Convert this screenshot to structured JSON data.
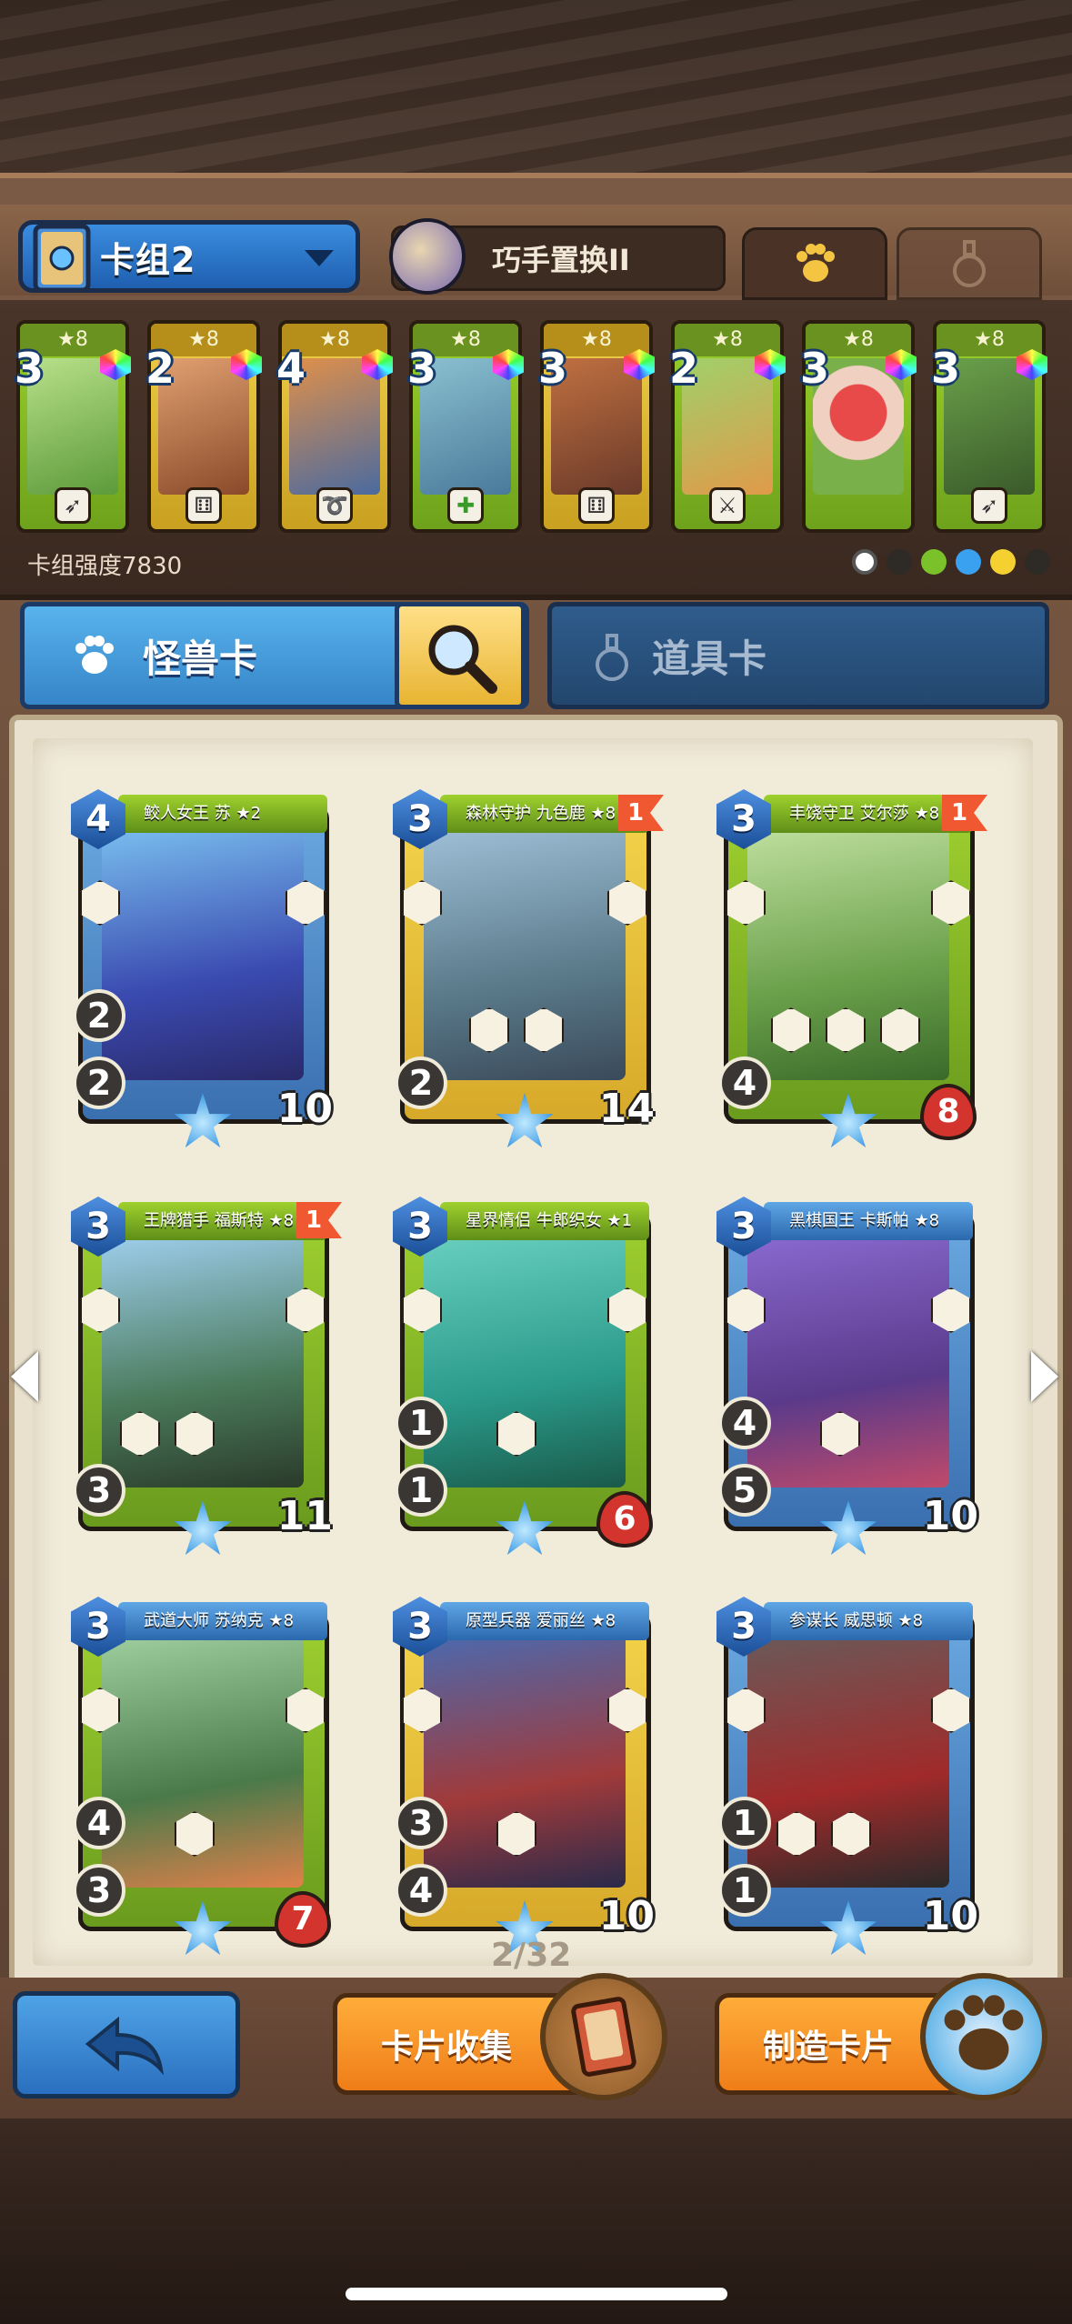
{
  "deck": {
    "name": "卡组2",
    "skill_name": "巧手置换II",
    "strength_label": "卡组强度7830"
  },
  "deck_cards": [
    {
      "cost": "3",
      "stars": "★8",
      "trait": "bow-icon",
      "color": "#9ad12a"
    },
    {
      "cost": "2",
      "stars": "★8",
      "trait": "dice-icon",
      "color": "#e8c44a"
    },
    {
      "cost": "4",
      "stars": "★8",
      "trait": "whip-icon",
      "color": "#e8c44a"
    },
    {
      "cost": "3",
      "stars": "★8",
      "trait": "clover-icon",
      "color": "#9ad12a"
    },
    {
      "cost": "3",
      "stars": "★8",
      "trait": "dice-icon",
      "color": "#e8c44a"
    },
    {
      "cost": "2",
      "stars": "★8",
      "trait": "sword-icon",
      "color": "#9ad12a"
    },
    {
      "cost": "3",
      "stars": "★8",
      "trait": "none",
      "color": "#9ad12a"
    },
    {
      "cost": "3",
      "stars": "★8",
      "trait": "bow-icon",
      "color": "#9ad12a"
    }
  ],
  "tabs": {
    "monster": "怪兽卡",
    "item": "道具卡"
  },
  "cards": [
    {
      "name": "鲛人女王 苏 ★2",
      "cost": "4",
      "flag": "",
      "atk1": "2",
      "atk2": "2",
      "hp": "10",
      "ribbon": "green",
      "art": "#3f6fd1"
    },
    {
      "name": "森林守护 九色鹿 ★8",
      "cost": "3",
      "flag": "1",
      "atk1": "",
      "atk2": "2",
      "hp": "14",
      "ribbon": "green",
      "art": "#6a8b7a"
    },
    {
      "name": "丰饶守卫 艾尔莎 ★8",
      "cost": "3",
      "flag": "1",
      "atk1": "",
      "atk2": "4",
      "hp": "8",
      "ribbon": "green",
      "art": "#6da04a"
    },
    {
      "name": "王牌猎手 福斯特 ★8",
      "cost": "3",
      "flag": "1",
      "atk1": "",
      "atk2": "3",
      "hp": "11",
      "ribbon": "green",
      "art": "#4a7a5a"
    },
    {
      "name": "星界情侣 牛郎织女 ★1",
      "cost": "3",
      "flag": "",
      "atk1": "1",
      "atk2": "1",
      "hp": "6",
      "ribbon": "green",
      "art": "#3aa08a"
    },
    {
      "name": "黑棋国王 卡斯帕 ★8",
      "cost": "3",
      "flag": "",
      "atk1": "4",
      "atk2": "5",
      "hp": "10",
      "ribbon": "blue",
      "art": "#5a3a8a"
    },
    {
      "name": "武道大师 苏纳克 ★8",
      "cost": "3",
      "flag": "",
      "atk1": "4",
      "atk2": "3",
      "hp": "7",
      "ribbon": "blue",
      "art": "#4a7a4a"
    },
    {
      "name": "原型兵器 爱丽丝 ★8",
      "cost": "3",
      "flag": "",
      "atk1": "3",
      "atk2": "4",
      "hp": "10",
      "ribbon": "blue",
      "art": "#3a4a8a"
    },
    {
      "name": "参谋长 威思顿 ★8",
      "cost": "3",
      "flag": "",
      "atk1": "1",
      "atk2": "1",
      "hp": "10",
      "ribbon": "blue",
      "art": "#5a4a4a"
    }
  ],
  "pagination": "2/32",
  "buttons": {
    "collect": "卡片收集",
    "craft": "制造卡片"
  }
}
